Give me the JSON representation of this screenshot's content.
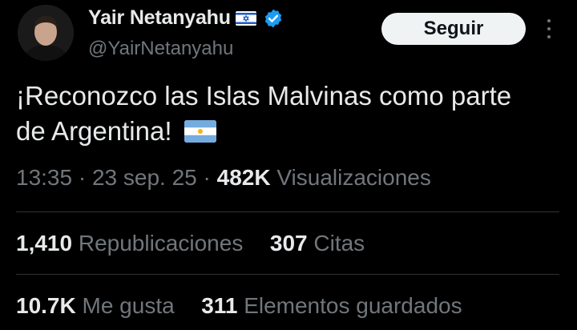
{
  "author": {
    "display_name": "Yair Netanyahu",
    "handle": "@YairNetanyahu",
    "flag_icon": "israel-flag-icon",
    "verified_icon": "verified-badge-icon",
    "verified_color": "#1d9bf0"
  },
  "actions": {
    "follow_label": "Seguir",
    "more_icon": "more-options-icon"
  },
  "tweet": {
    "text": "¡Reconozco las Islas Malvinas como parte de Argentina!",
    "trailing_icon": "argentina-flag-icon"
  },
  "meta": {
    "time": "13:35",
    "separator": "·",
    "date": "23 sep. 25",
    "views_count": "482K",
    "views_label": "Visualizaciones"
  },
  "stats": {
    "reposts_count": "1,410",
    "reposts_label": "Republicaciones",
    "quotes_count": "307",
    "quotes_label": "Citas",
    "likes_count": "10.7K",
    "likes_label": "Me gusta",
    "bookmarks_count": "311",
    "bookmarks_label": "Elementos guardados"
  },
  "colors": {
    "background": "#000000",
    "text": "#e7e9ea",
    "muted": "#71767b",
    "divider": "#2f3336",
    "button_bg": "#eff3f4"
  }
}
